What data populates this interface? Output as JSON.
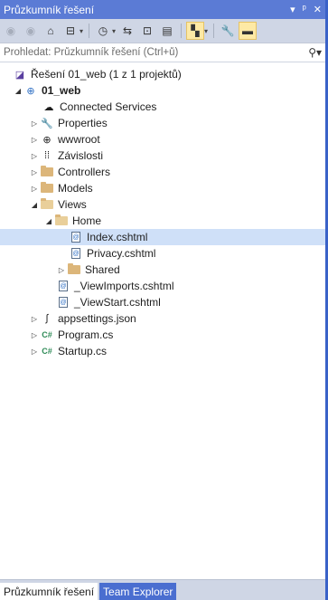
{
  "window": {
    "title": "Průzkumník řešení",
    "pin_label": "▾ ᵖ",
    "close_label": "✕"
  },
  "toolbar": {
    "icons": [
      "back-icon",
      "forward-icon",
      "home-icon",
      "sync-views-icon",
      "pending-changes-icon",
      "refresh-icon",
      "collapse-all-icon",
      "show-all-files-icon",
      "preview-icon",
      "properties-icon",
      "dock-icon"
    ]
  },
  "search": {
    "placeholder": "Prohledat: Průzkumník řešení (Ctrl+ů)"
  },
  "tree": {
    "solution": "Řešení 01_web (1 z 1 projektů)",
    "project": "01_web",
    "items": [
      {
        "label": "Connected Services"
      },
      {
        "label": "Properties"
      },
      {
        "label": "wwwroot"
      },
      {
        "label": "Závislosti"
      },
      {
        "label": "Controllers"
      },
      {
        "label": "Models"
      },
      {
        "label": "Views"
      },
      {
        "label": "Home"
      },
      {
        "label": "Index.cshtml"
      },
      {
        "label": "Privacy.cshtml"
      },
      {
        "label": "Shared"
      },
      {
        "label": "_ViewImports.cshtml"
      },
      {
        "label": "_ViewStart.cshtml"
      },
      {
        "label": "appsettings.json"
      },
      {
        "label": "Program.cs"
      },
      {
        "label": "Startup.cs"
      }
    ]
  },
  "tabs": {
    "solution_explorer": "Průzkumník řešení",
    "team_explorer": "Team Explorer"
  },
  "colors": {
    "title_bar": "#5b7bd5",
    "selection": "#cfe0f8",
    "folder": "#dcb67a",
    "accent_border": "#3a62c8"
  }
}
